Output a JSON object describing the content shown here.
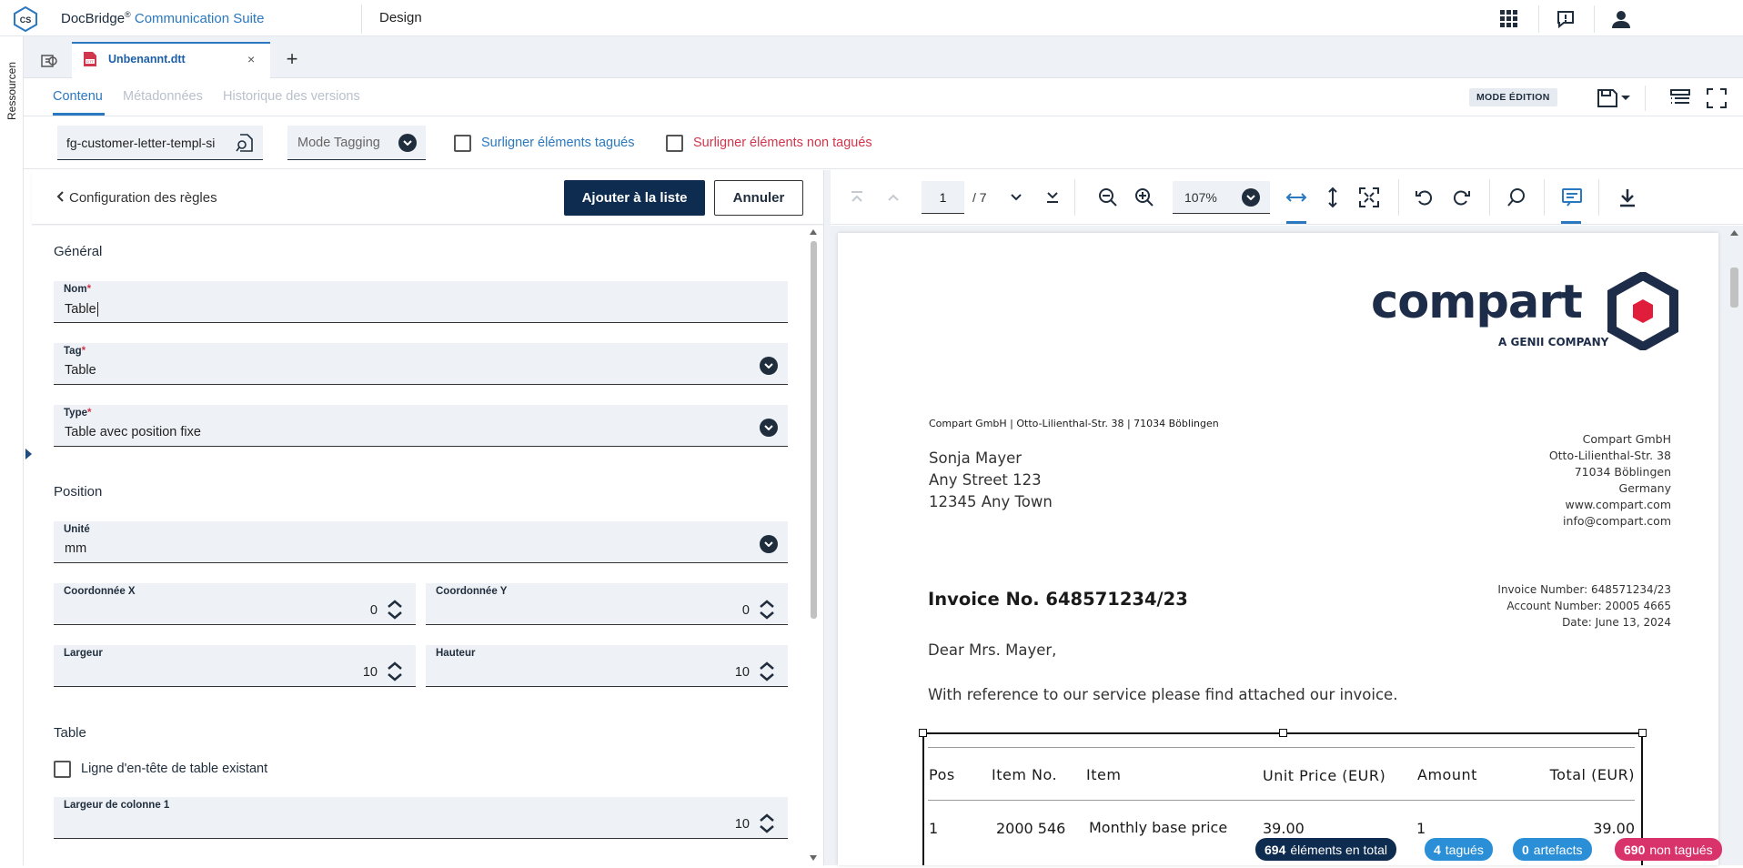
{
  "header": {
    "brand": "DocBridge",
    "brand_reg": "®",
    "product": "Communication Suite",
    "logo_text": "CS",
    "section": "Design"
  },
  "rail": {
    "label": "Ressourcen"
  },
  "tabs": [
    {
      "name": "Unbenannt.dtt",
      "close": "×"
    }
  ],
  "tab_add": "+",
  "subtabs": {
    "content": "Contenu",
    "metadata": "Métadonnées",
    "history": "Historique des versions"
  },
  "mode_badge": "MODE ÉDITION",
  "toolbar": {
    "template": "fg-customer-letter-templ-si",
    "tagging_mode": "Mode Tagging",
    "highlight_tagged": "Surligner éléments tagués",
    "highlight_untagged": "Surligner éléments non tagués"
  },
  "panel": {
    "back_label": "Configuration des règles",
    "add_button": "Ajouter à la liste",
    "cancel_button": "Annuler"
  },
  "form": {
    "general_title": "Général",
    "name_label": "Nom",
    "name_value": "Table",
    "tag_label": "Tag",
    "tag_value": "Table",
    "type_label": "Type",
    "type_value": "Table avec position fixe",
    "position_title": "Position",
    "unit_label": "Unité",
    "unit_value": "mm",
    "x_label": "Coordonnée X",
    "x_value": "0",
    "y_label": "Coordonnée Y",
    "y_value": "0",
    "width_label": "Largeur",
    "width_value": "10",
    "height_label": "Hauteur",
    "height_value": "10",
    "table_title": "Table",
    "header_row_label": "Ligne d'en-tête de table existant",
    "col_width_label": "Largeur de colonne 1",
    "col_width_value": "10",
    "required_mark": "*"
  },
  "viewer": {
    "page": "1",
    "page_total": "/ 7",
    "zoom": "107%"
  },
  "document": {
    "logo_word": "compart",
    "logo_sub": "A GENII COMPANY",
    "sender_line": "Compart GmbH | Otto-Lilienthal-Str. 38 | 71034 Böblingen",
    "recipient": [
      "Sonja Mayer",
      "Any Street 123",
      "12345 Any Town"
    ],
    "company_block": [
      "Compart GmbH",
      "Otto-Lilienthal-Str. 38",
      "71034 Böblingen",
      "Germany",
      "www.compart.com",
      "info@compart.com"
    ],
    "invoice_title": "Invoice No. 648571234/23",
    "invoice_meta": [
      "Invoice Number: 648571234/23",
      "Account Number: 20005 4665",
      "Date: June 13, 2024"
    ],
    "greeting": "Dear Mrs. Mayer,",
    "intro": "With reference to our service please find attached our invoice.",
    "table_headers": [
      "Pos",
      "Item No.",
      "Item",
      "Unit Price (EUR)",
      "Amount",
      "Total (EUR)"
    ],
    "table_rows": [
      [
        "1",
        "2000 546",
        "Monthly base price",
        "39.00",
        "1",
        "39.00"
      ]
    ]
  },
  "status": {
    "total_count": "694",
    "total_label": "éléments en total",
    "tagged_count": "4",
    "tagged_label": "tagués",
    "artefact_count": "0",
    "artefact_label": "artefacts",
    "untagged_count": "690",
    "untagged_label": "non tagués"
  },
  "colors": {
    "accent": "#2a78c0",
    "primary_dark": "#0e2c4f",
    "danger": "#d0364c",
    "logo_red": "#e01e3c",
    "badge_total": "#0e2c4f",
    "badge_tagged": "#2a8fd6",
    "badge_untagged": "#d9336b"
  }
}
